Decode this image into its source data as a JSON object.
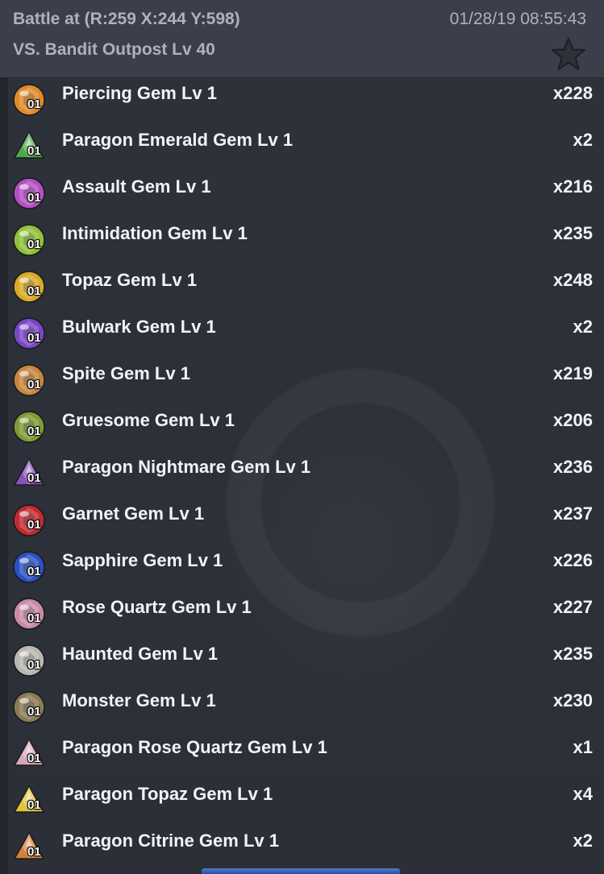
{
  "header": {
    "title": "Battle at (R:259 X:244 Y:598)",
    "subtitle": "VS. Bandit Outpost Lv 40",
    "datetime": "01/28/19 08:55:43",
    "favorite_icon": "star-outline-icon"
  },
  "items": [
    {
      "name": "Piercing Gem Lv 1",
      "qty": "x228",
      "level": "01",
      "color": "#e08a2a",
      "shape": "round"
    },
    {
      "name": "Paragon Emerald Gem Lv 1",
      "qty": "x2",
      "level": "01",
      "color": "#4fa84a",
      "shape": "triangle"
    },
    {
      "name": "Assault Gem Lv 1",
      "qty": "x216",
      "level": "01",
      "color": "#b44fc4",
      "shape": "round"
    },
    {
      "name": "Intimidation Gem Lv 1",
      "qty": "x235",
      "level": "01",
      "color": "#8fc23a",
      "shape": "round"
    },
    {
      "name": "Topaz Gem Lv 1",
      "qty": "x248",
      "level": "01",
      "color": "#d9a926",
      "shape": "round"
    },
    {
      "name": "Bulwark Gem Lv 1",
      "qty": "x2",
      "level": "01",
      "color": "#7a46c8",
      "shape": "round"
    },
    {
      "name": "Spite Gem Lv 1",
      "qty": "x219",
      "level": "01",
      "color": "#c98540",
      "shape": "round"
    },
    {
      "name": "Gruesome Gem Lv 1",
      "qty": "x206",
      "level": "01",
      "color": "#7f9b34",
      "shape": "round"
    },
    {
      "name": "Paragon Nightmare Gem Lv 1",
      "qty": "x236",
      "level": "01",
      "color": "#8a4fc0",
      "shape": "triangle"
    },
    {
      "name": "Garnet Gem Lv 1",
      "qty": "x237",
      "level": "01",
      "color": "#c22a32",
      "shape": "round"
    },
    {
      "name": "Sapphire Gem Lv 1",
      "qty": "x226",
      "level": "01",
      "color": "#2a52c4",
      "shape": "round"
    },
    {
      "name": "Rose Quartz Gem Lv 1",
      "qty": "x227",
      "level": "01",
      "color": "#c98aa8",
      "shape": "round"
    },
    {
      "name": "Haunted Gem Lv 1",
      "qty": "x235",
      "level": "01",
      "color": "#b8b6ae",
      "shape": "round"
    },
    {
      "name": "Monster Gem Lv 1",
      "qty": "x230",
      "level": "01",
      "color": "#8a7a56",
      "shape": "round"
    },
    {
      "name": "Paragon Rose Quartz Gem Lv 1",
      "qty": "x1",
      "level": "01",
      "color": "#d6a6bc",
      "shape": "triangle"
    },
    {
      "name": "Paragon Topaz Gem Lv 1",
      "qty": "x4",
      "level": "01",
      "color": "#e2c43a",
      "shape": "triangle"
    },
    {
      "name": "Paragon Citrine Gem Lv 1",
      "qty": "x2",
      "level": "01",
      "color": "#d2803a",
      "shape": "triangle"
    }
  ]
}
